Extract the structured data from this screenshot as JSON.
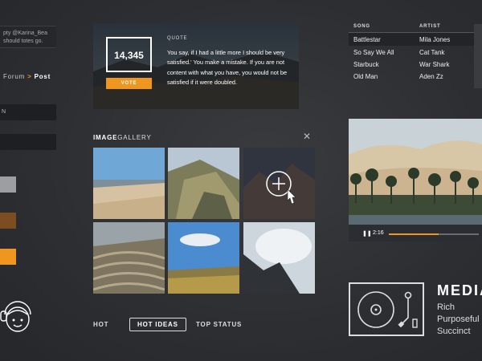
{
  "left": {
    "tweet_text": "pty @Karina_Bea",
    "tweet_text2": "should totes go.",
    "breadcrumb": {
      "previous": "Forum",
      "separator": ">",
      "current": "Post"
    },
    "field_1": "N",
    "field_2": "",
    "swatches": [
      "#9d9ea2",
      "#7c4d21",
      "#ee961e"
    ]
  },
  "quote_card": {
    "stat_value": "14,345",
    "vote_label": "VOTE",
    "label": "QUOTE",
    "text": "You say, if I had a little more I should be very satisfied.' You make a mistake. If you are not content with what you have, you would not be satisfied if it were doubled."
  },
  "gallery": {
    "title_bold": "IMAGE",
    "title_rest": "GALLERY",
    "close_icon": "close-icon",
    "add_icon": "plus-icon",
    "cursor_icon": "hand-pointer-icon"
  },
  "tabs": [
    {
      "label": "HOT"
    },
    {
      "label": "HOT IDEAS",
      "active": true
    },
    {
      "label": "TOP STATUS"
    }
  ],
  "songs": {
    "headers": {
      "song": "SONG",
      "artist": "ARTIST"
    },
    "rows": [
      {
        "song": "Battlestar",
        "artist": "Mila Jones",
        "highlighted": true
      },
      {
        "song": "So Say We All",
        "artist": "Cat Tank"
      },
      {
        "song": "Starbuck",
        "artist": "War Shark"
      },
      {
        "song": "Old Man",
        "artist": "Aden Zz"
      }
    ]
  },
  "video": {
    "time": "2:16",
    "progress": 0.55,
    "accent": "#ee961e"
  },
  "media": {
    "title": "MEDIA",
    "words": [
      "Rich",
      "Purposeful",
      "Succinct"
    ],
    "icon": "turntable-icon"
  }
}
